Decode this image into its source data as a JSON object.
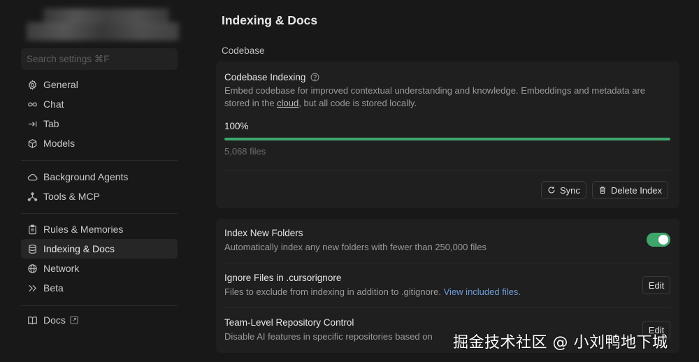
{
  "sidebar": {
    "search_placeholder": "Search settings ⌘F",
    "group1": [
      {
        "label": "General",
        "icon": "gear-icon"
      },
      {
        "label": "Chat",
        "icon": "infinity-icon"
      },
      {
        "label": "Tab",
        "icon": "tab-arrow-icon"
      },
      {
        "label": "Models",
        "icon": "cube-icon"
      }
    ],
    "group2": [
      {
        "label": "Background Agents",
        "icon": "cloud-icon"
      },
      {
        "label": "Tools & MCP",
        "icon": "nodes-icon"
      }
    ],
    "group3": [
      {
        "label": "Rules & Memories",
        "icon": "clipboard-icon"
      },
      {
        "label": "Indexing & Docs",
        "icon": "database-icon",
        "active": true
      },
      {
        "label": "Network",
        "icon": "globe-icon"
      },
      {
        "label": "Beta",
        "icon": "double-chevron-icon"
      }
    ],
    "docs": {
      "label": "Docs",
      "icon": "book-icon"
    }
  },
  "main": {
    "title": "Indexing & Docs",
    "section": "Codebase",
    "indexing": {
      "title": "Codebase Indexing",
      "desc_part1": "Embed codebase for improved contextual understanding and knowledge. Embeddings and metadata are stored in the ",
      "desc_link": "cloud",
      "desc_part2": ", but all code is stored locally.",
      "progress_label": "100%",
      "progress_value": 1.0,
      "files": "5,068 files",
      "sync_label": "Sync",
      "delete_label": "Delete Index"
    },
    "settings": {
      "new_folders_title": "Index New Folders",
      "new_folders_desc": "Automatically index any new folders with fewer than 250,000 files",
      "new_folders_enabled": true,
      "ignore_title": "Ignore Files in .cursorignore",
      "ignore_desc": "Files to exclude from indexing in addition to .gitignore. ",
      "ignore_link": "View included files.",
      "edit_label": "Edit",
      "team_title": "Team-Level Repository Control",
      "team_desc": "Disable AI features in specific repositories based on"
    }
  },
  "watermark": "掘金技术社区 @ 小刘鸭地下城",
  "colors": {
    "accent_green": "#3fa66b",
    "link_blue": "#6e9ad8",
    "bg": "#181818",
    "card": "#1f1f1f"
  }
}
